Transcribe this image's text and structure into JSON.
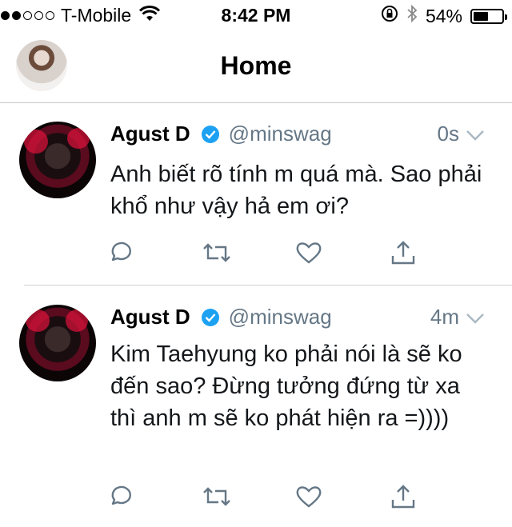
{
  "status_bar": {
    "carrier": "T-Mobile",
    "time": "8:42 PM",
    "battery": "54%",
    "battery_level": 0.54
  },
  "header": {
    "title": "Home"
  },
  "tweets": [
    {
      "name": "Agust D",
      "handle": "@minswag",
      "time": "0s",
      "text": "Anh biết rõ tính m quá mà. Sao phải khổ như vậy hả em ơi?"
    },
    {
      "name": "Agust D",
      "handle": "@minswag",
      "time": "4m",
      "text": "Kim Taehyung ko phải nói là sẽ ko đến sao? Đừng tưởng đứng từ xa thì anh m sẽ ko phát hiện ra =))))"
    }
  ],
  "icons": {
    "reply": "reply-icon",
    "retweet": "retweet-icon",
    "like": "heart-icon",
    "share": "share-icon",
    "verified": "verified-badge-icon",
    "more": "chevron-down-icon"
  },
  "colors": {
    "verified_blue": "#1da1f2",
    "handle_gray": "#657786",
    "icon_gray": "#657786"
  }
}
